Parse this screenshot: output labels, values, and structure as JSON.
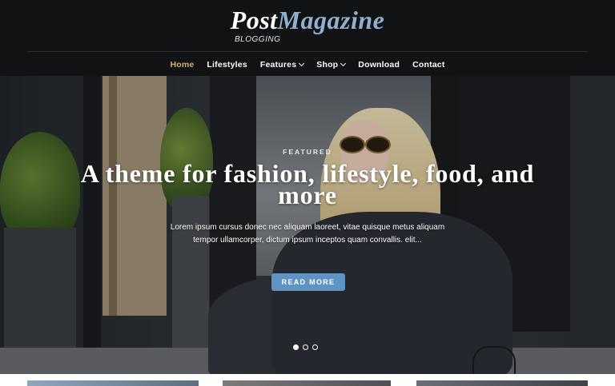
{
  "brand": {
    "logo_post": "Post",
    "logo_magazine": "Magazine",
    "tagline": "BLOGGING"
  },
  "nav": {
    "items": [
      {
        "label": "Home",
        "active": true
      },
      {
        "label": "Lifestyles"
      },
      {
        "label": "Features",
        "dropdown": true
      },
      {
        "label": "Shop",
        "dropdown": true
      },
      {
        "label": "Download"
      },
      {
        "label": "Contact"
      }
    ]
  },
  "hero": {
    "kicker": "FEATURED",
    "title": "A theme for fashion, lifestyle, food, and more",
    "excerpt": "Lorem ipsum cursus donec nec aliquam laoreet, vitae quisque metus aliquam tempor ullamcorper, dictum ipsum inceptos quam convallis. elit...",
    "button": "READ MORE",
    "slides_total": 3,
    "active_slide": 1
  },
  "colors": {
    "header_bg": "#111214",
    "accent_active": "#d4b06a",
    "logo_accent": "#8fb0cf",
    "button_bg": "#5e94c4"
  },
  "icons": {
    "dropdown": "chevron-down-icon",
    "slider_dot": "slider-dot-icon"
  }
}
